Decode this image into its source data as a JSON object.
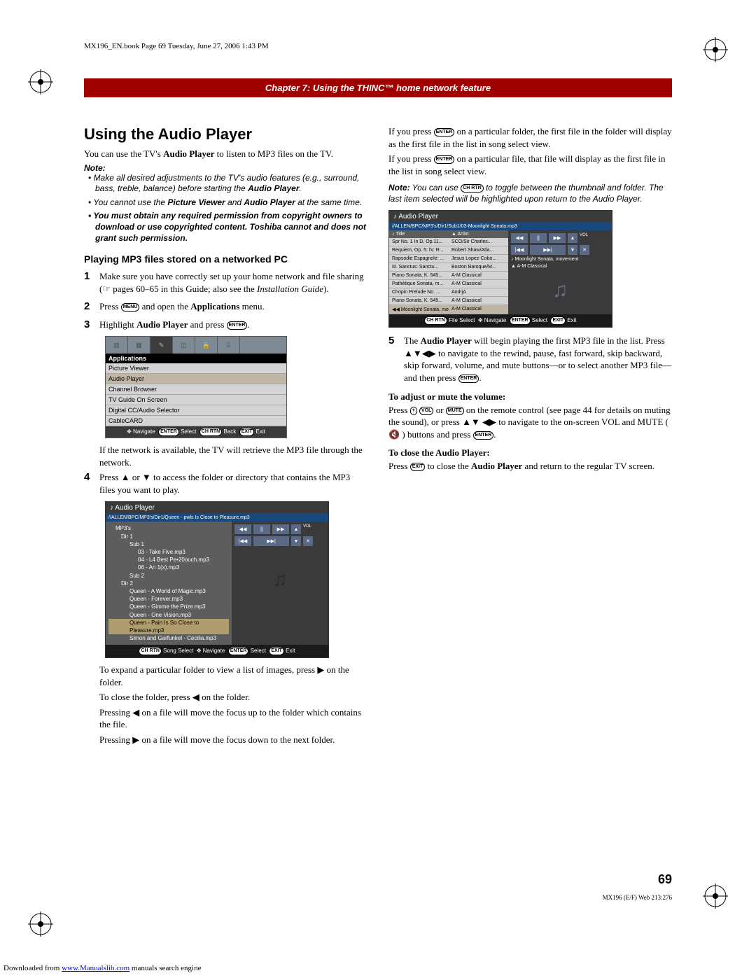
{
  "book_header": "MX196_EN.book  Page 69  Tuesday, June 27, 2006  1:43 PM",
  "chapter_bar": "Chapter 7: Using the THINC™ home network feature",
  "h1": "Using the Audio Player",
  "intro_pre": "You can use the TV's ",
  "intro_bold": "Audio Player",
  "intro_post": " to listen to MP3 files on the TV.",
  "note_label": "Note:",
  "notes": {
    "n1a": "Make all desired adjustments to the TV's audio features (e.g., surround, bass, treble, balance) before starting the ",
    "n1b": "Audio Player",
    "n1c": ".",
    "n2a": "You cannot use the ",
    "n2b": "Picture Viewer",
    "n2c": " and ",
    "n2d": "Audio Player",
    "n2e": " at the same time.",
    "n3": "You must obtain any required permission from copyright owners to download or use copyrighted content. Toshiba cannot and does not grant such permission."
  },
  "h2a": "Playing MP3 files stored on a networked PC",
  "step1a": "Make sure you have correctly set up your home network and file sharing (☞ pages 60–65 in this Guide; also see the ",
  "step1b": "Installation Guide",
  "step1c": ").",
  "step2a": "Press ",
  "step2_menu": "MENU",
  "step2b": " and open the ",
  "step2c": "Applications",
  "step2d": " menu.",
  "step3a": "Highlight ",
  "step3b": "Audio Player",
  "step3c": " and press ",
  "step3_enter": "ENTER",
  "step3d": ".",
  "app_menu": {
    "header": "Applications",
    "items": [
      "Picture Viewer",
      "Audio Player",
      "Channel Browser",
      "TV Guide On Screen",
      "Digital CC/Audio Selector",
      "CableCARD"
    ],
    "footer": {
      "nav": "Navigate",
      "sel": "Select",
      "back": "Back",
      "exit": "Exit",
      "enter": "ENTER",
      "chrtn": "CH RTN",
      "exitb": "EXIT"
    }
  },
  "after_menu": "If the network is available, the TV will retrieve the MP3 file through the network.",
  "step4": "Press ▲ or ▼ to access the folder or directory that contains the MP3 files you want to play.",
  "audio_ui": {
    "title": "Audio Player",
    "path": "//ALLEN/BPC/MP3's/Dir1/Queen - pwls Is Close to Pleasure.mp3",
    "tree": {
      "root": "MP3's",
      "dir1": "Dir 1",
      "sub1": "Sub 1",
      "f1": "03 - Take Five.mp3",
      "f2": "04 - L4 Best Pe•20ouch.mp3",
      "f3": "06 - An 1(x).mp3",
      "sub2": "Sub 2",
      "dir2": "Dir 2",
      "q1": "Queen - A World of Magic.mp3",
      "q2": "Queen - Forever.mp3",
      "q3": "Queen - Gimme the Prize.mp3",
      "q4": "Queen - One Vision.mp3",
      "q5": "Queen - Pain Is So Close to Pleasure.mp3",
      "sg": "Simon and Garfunkel - Cecilia.mp3"
    },
    "ctrl": {
      "rw": "◀◀",
      "pl": "||",
      "ff": "▶▶",
      "sb": "|◀◀",
      "sf": "▶▶|",
      "vol": "VOL",
      "up": "▲",
      "dn": "▼",
      "mute": "✕"
    },
    "footer": {
      "ss": "Song Select",
      "nav": "Navigate",
      "sel": "Select",
      "exit": "Exit",
      "chrtn": "CH RTN",
      "enter": "ENTER",
      "exitb": "EXIT"
    }
  },
  "after_ui_p1a": "To expand a particular folder to view a list of images, press ▶ on the folder.",
  "after_ui_p2": "To close the folder, press ◀ on the folder.",
  "after_ui_p3": "Pressing ◀ on a file will move the focus up to the folder which contains the file.",
  "after_ui_p4": "Pressing ▶ on a file will move the focus down to the next folder.",
  "col2_p1a": "If you press ",
  "col2_enter": "ENTER",
  "col2_p1b": " on a particular folder, the first file in the folder will display as the first file in the list in song select view.",
  "col2_p2a": "If you press ",
  "col2_p2b": " on a particular file, that file will display as the first file in the list in song select view.",
  "col2_note_lbl": "Note:",
  "col2_note_a": " You can use ",
  "col2_note_chrtn": "CH RTN",
  "col2_note_b": " to toggle between the thumbnail and folder. The last item selected will be highlighted upon return to the Audio Player.",
  "audio_ui2": {
    "title": "Audio Player",
    "path": "//ALLEN/BPC/MP3's/Dir1/Sub1/03-Moonlight Sonata.mp3",
    "cols": {
      "title": "♪ Title",
      "artist": "▲ Artist"
    },
    "rows": [
      {
        "t": "Spr No. 1 In D, Op.11...",
        "a": "SCO/Sir Charles..."
      },
      {
        "t": "Requiem, Op. 5: IV. R...",
        "a": "Robert Shaw/Atla..."
      },
      {
        "t": "Rapsodie Espagnole: ...",
        "a": "Jesus Lopez-Cobo..."
      },
      {
        "t": "III. Sanctus: Sanctu...",
        "a": "Boston Baroque/M..."
      },
      {
        "t": "Piano Sonata, K. 545...",
        "a": "A-M Classical"
      },
      {
        "t": "Pathétique Sonata, m...",
        "a": "A-M Classical"
      },
      {
        "t": "Chopin Prelude No. ...",
        "a": "Andrj∆"
      },
      {
        "t": "Piano Sonata, K. 545...",
        "a": "A-M Classical"
      }
    ],
    "np_row": {
      "t": "◀◀ Moonlight Sonata, mo...",
      "a": "A-M Classical"
    },
    "np_title": "♪ Moonlight Sonata, movement",
    "np_artist": "▲ A-M Classical",
    "footer": {
      "fs": "File Select",
      "nav": "Navigate",
      "sel": "Select",
      "exit": "Exit",
      "chrtn": "CH RTN",
      "enter": "ENTER",
      "exitb": "EXIT"
    }
  },
  "step5a": "The ",
  "step5b": "Audio Player",
  "step5c": " will begin playing the first MP3 file in the list. Press ▲▼◀▶ to navigate to the rewind, pause, fast forward, skip backward, skip forward, volume, and mute buttons—or to select another MP3 file—and then press ",
  "step5_enter": "ENTER",
  "step5d": ".",
  "h3a": "To adjust or mute the volume:",
  "vol_p_a": "Press ",
  "vol_b1": "+",
  "vol_b2": "VOL",
  "vol_b3": "MUTE",
  "vol_p_b": " on the remote control (see page 44 for details on muting the sound), or press ▲▼ ◀▶ to navigate to the on-screen VOL and MUTE ( 🔇 ) buttons and press ",
  "vol_enter": "ENTER",
  "vol_p_c": ".",
  "h3b": "To close the Audio Player:",
  "close_a": "Press ",
  "close_exit": "EXIT",
  "close_b": " to close the ",
  "close_c": "Audio Player",
  "close_d": " and return to the regular TV screen.",
  "page_num": "69",
  "footer_code": "MX196 (E/F) Web 213:276",
  "dl_pre": "Downloaded from ",
  "dl_link": "www.Manualslib.com",
  "dl_post": " manuals search engine"
}
